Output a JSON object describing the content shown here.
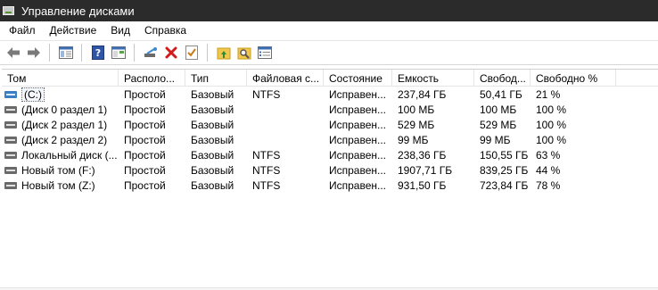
{
  "window": {
    "title": "Управление дисками"
  },
  "menu": [
    {
      "label": "Файл"
    },
    {
      "label": "Действие"
    },
    {
      "label": "Вид"
    },
    {
      "label": "Справка"
    }
  ],
  "toolbar": {
    "buttons": [
      "back-arrow-icon",
      "forward-arrow-icon",
      "show-hide-console-tree-icon",
      "help-icon",
      "properties-icon",
      "connect-disk-icon",
      "delete-icon",
      "check-icon",
      "folder-up-icon",
      "search-folder-icon",
      "list-properties-icon"
    ]
  },
  "table": {
    "columns": [
      "Том",
      "Располо...",
      "Тип",
      "Файловая с...",
      "Состояние",
      "Емкость",
      "Свобод...",
      "Свободно %"
    ],
    "rows": [
      {
        "vol": "(C:)",
        "layout": "Простой",
        "type": "Базовый",
        "fs": "NTFS",
        "state": "Исправен...",
        "capacity": "237,84 ГБ",
        "free": "50,41 ГБ",
        "pct": "21 %",
        "selected": true
      },
      {
        "vol": "(Диск 0 раздел 1)",
        "layout": "Простой",
        "type": "Базовый",
        "fs": "",
        "state": "Исправен...",
        "capacity": "100 МБ",
        "free": "100 МБ",
        "pct": "100 %"
      },
      {
        "vol": "(Диск 2 раздел 1)",
        "layout": "Простой",
        "type": "Базовый",
        "fs": "",
        "state": "Исправен...",
        "capacity": "529 МБ",
        "free": "529 МБ",
        "pct": "100 %"
      },
      {
        "vol": "(Диск 2 раздел 2)",
        "layout": "Простой",
        "type": "Базовый",
        "fs": "",
        "state": "Исправен...",
        "capacity": "99 МБ",
        "free": "99 МБ",
        "pct": "100 %"
      },
      {
        "vol": "Локальный диск (...",
        "layout": "Простой",
        "type": "Базовый",
        "fs": "NTFS",
        "state": "Исправен...",
        "capacity": "238,36 ГБ",
        "free": "150,55 ГБ",
        "pct": "63 %"
      },
      {
        "vol": "Новый том (F:)",
        "layout": "Простой",
        "type": "Базовый",
        "fs": "NTFS",
        "state": "Исправен...",
        "capacity": "1907,71 ГБ",
        "free": "839,25 ГБ",
        "pct": "44 %"
      },
      {
        "vol": "Новый том (Z:)",
        "layout": "Простой",
        "type": "Базовый",
        "fs": "NTFS",
        "state": "Исправен...",
        "capacity": "931,50 ГБ",
        "free": "723,84 ГБ",
        "pct": "78 %"
      }
    ]
  }
}
